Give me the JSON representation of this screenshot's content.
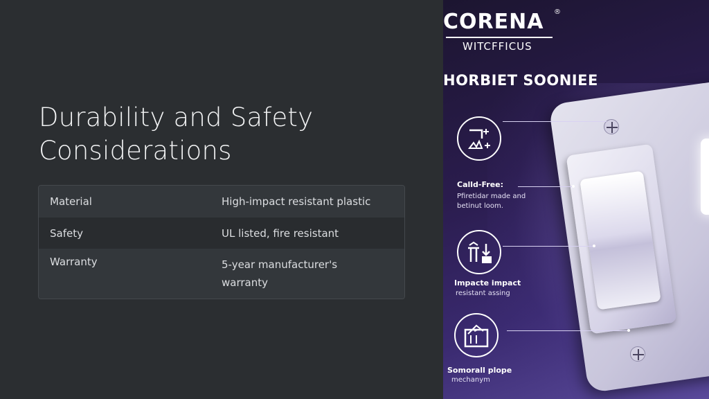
{
  "slide": {
    "title": "Durability and Safety Considerations",
    "table": [
      {
        "label": "Material",
        "value": "High-impact resistant plastic"
      },
      {
        "label": "Safety",
        "value": "UL listed, fire resistant"
      },
      {
        "label": "Warranty",
        "value": "5-year manufacturer's warranty"
      }
    ]
  },
  "image": {
    "brand": "CORENA",
    "brand_mark": "®",
    "brand_sub": "WITCFFICUS",
    "product": "HORBIET SOONIEE",
    "features": [
      {
        "title": "Calld-Free:",
        "desc": "Pfiretidar made and betinut loom.",
        "icon": "wiring-icon"
      },
      {
        "title": "Impacte impact",
        "desc": "resistant assing",
        "icon": "impact-icon"
      },
      {
        "title": "Somorall plope",
        "desc": "mechanym",
        "icon": "mechanism-icon"
      }
    ],
    "colors": {
      "background": "#2a1c4d",
      "accent": "#ffffff"
    }
  }
}
